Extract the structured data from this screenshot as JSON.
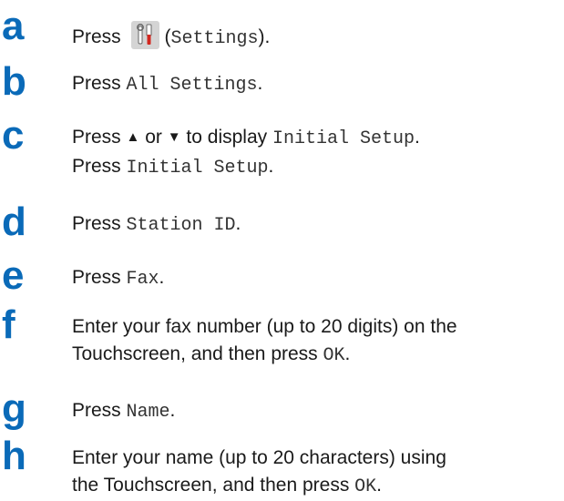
{
  "steps": [
    {
      "letter": "a",
      "segments": [
        {
          "t": "Press "
        },
        {
          "icon": "settings-icon"
        },
        {
          "t": "(",
          "mono": false
        },
        {
          "t": "Settings",
          "mono": true
        },
        {
          "t": ")."
        }
      ]
    },
    {
      "letter": "b",
      "segments": [
        {
          "t": "Press "
        },
        {
          "t": "All Settings",
          "mono": true
        },
        {
          "t": "."
        }
      ]
    },
    {
      "letter": "c",
      "lines": [
        [
          {
            "t": "Press "
          },
          {
            "t": "▲",
            "tri": true
          },
          {
            "t": " or "
          },
          {
            "t": "▼",
            "tri": true
          },
          {
            "t": " to display "
          },
          {
            "t": "Initial Setup",
            "mono": true
          },
          {
            "t": "."
          }
        ],
        [
          {
            "t": "Press "
          },
          {
            "t": "Initial Setup",
            "mono": true
          },
          {
            "t": "."
          }
        ]
      ]
    },
    {
      "letter": "d",
      "segments": [
        {
          "t": "Press "
        },
        {
          "t": "Station ID",
          "mono": true
        },
        {
          "t": "."
        }
      ]
    },
    {
      "letter": "e",
      "segments": [
        {
          "t": "Press "
        },
        {
          "t": "Fax",
          "mono": true
        },
        {
          "t": "."
        }
      ]
    },
    {
      "letter": "f",
      "lines": [
        [
          {
            "t": "Enter your fax number (up to 20 digits) on the"
          }
        ],
        [
          {
            "t": "Touchscreen, and then press "
          },
          {
            "t": "OK",
            "mono": true
          },
          {
            "t": "."
          }
        ]
      ]
    },
    {
      "letter": "g",
      "segments": [
        {
          "t": "Press "
        },
        {
          "t": "Name",
          "mono": true
        },
        {
          "t": "."
        }
      ]
    },
    {
      "letter": "h",
      "lines": [
        [
          {
            "t": "Enter your name (up to 20 characters) using"
          }
        ],
        [
          {
            "t": "the Touchscreen, and then press "
          },
          {
            "t": "OK",
            "mono": true
          },
          {
            "t": "."
          }
        ]
      ]
    }
  ],
  "colors": {
    "step_letter": "#0a6ab8",
    "text": "#1a1a1a"
  }
}
